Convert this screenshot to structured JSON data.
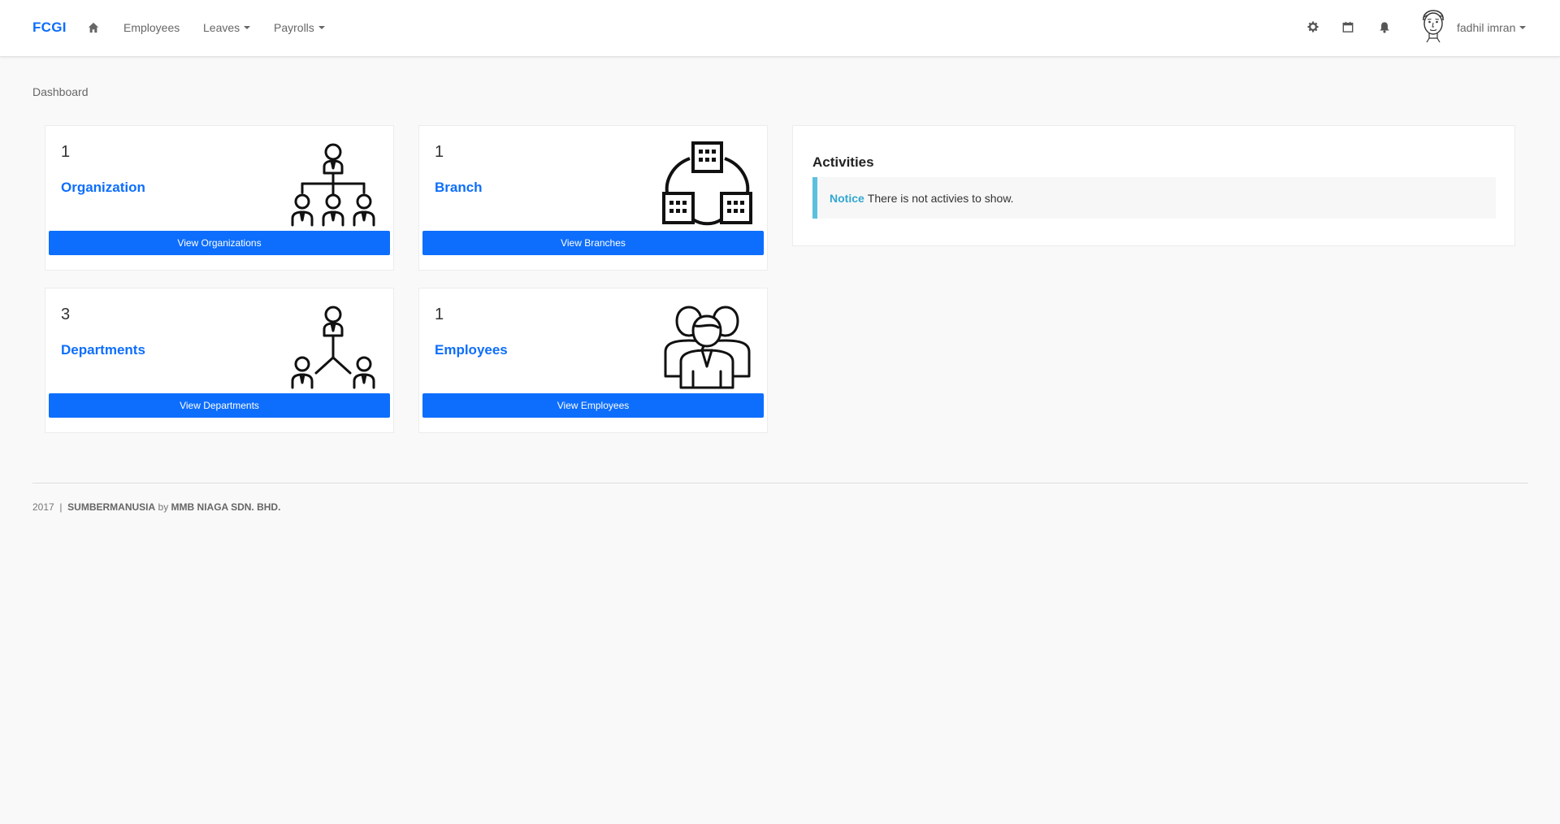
{
  "navbar": {
    "brand": "FCGI",
    "home_icon": "home-icon",
    "links": [
      {
        "label": "Employees"
      },
      {
        "label": "Leaves"
      },
      {
        "label": "Payrolls"
      }
    ],
    "right_icons": [
      "gear-icon",
      "calendar-icon",
      "bell-icon"
    ],
    "user_name": "fadhil imran"
  },
  "breadcrumb": "Dashboard",
  "cards": [
    {
      "count": "1",
      "label": "Organization",
      "button": "View Organizations",
      "icon": "org-chart-icon"
    },
    {
      "count": "1",
      "label": "Branch",
      "button": "View Branches",
      "icon": "branch-buildings-icon"
    },
    {
      "count": "3",
      "label": "Departments",
      "button": "View Departments",
      "icon": "departments-icon"
    },
    {
      "count": "1",
      "label": "Employees",
      "button": "View Employees",
      "icon": "employees-group-icon"
    }
  ],
  "activities": {
    "title": "Activities",
    "notice_label": "Notice",
    "notice_text": "There is not activies to show."
  },
  "footer": {
    "year": "2017",
    "separator": "|",
    "product": "SUMBERMANUSIA",
    "by": "by",
    "company": "MMB NIAGA SDN. BHD."
  },
  "colors": {
    "accent": "#0d6efd",
    "notice": "#5bc0de",
    "background": "#f9f9f9"
  }
}
